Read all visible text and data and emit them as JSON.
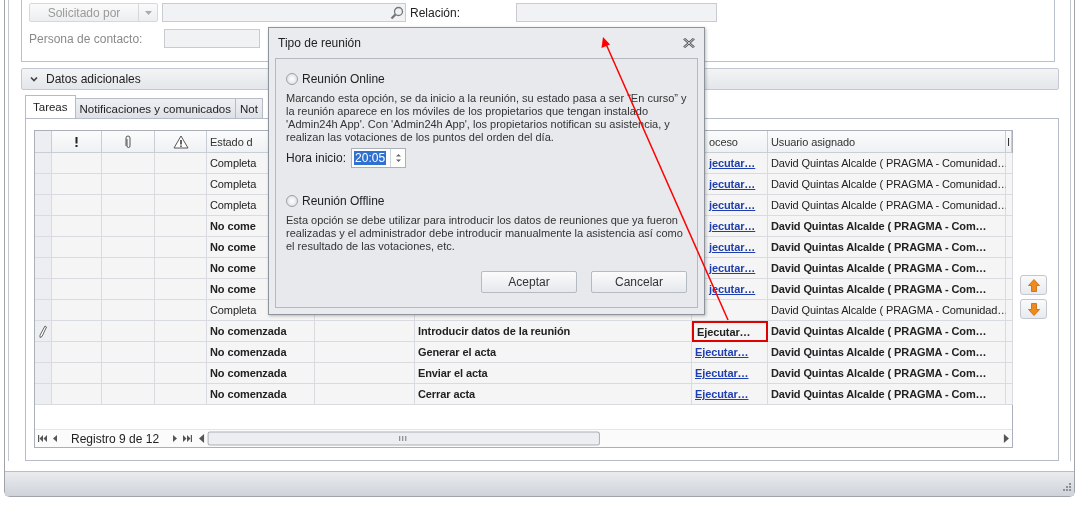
{
  "form": {
    "requester_button": {
      "label": "Solicitado por",
      "disabled": true
    },
    "relation_label": "Relación:",
    "contact_label": "Persona de contacto:"
  },
  "section": {
    "label": "Datos adicionales",
    "expanded": false
  },
  "tabs": [
    {
      "label": "Tareas",
      "selected": true
    },
    {
      "label": "Notificaciones y comunicados",
      "selected": false
    },
    {
      "label": "Not",
      "selected": false
    }
  ],
  "table": {
    "columns": [
      "Estado d",
      "oceso",
      "Usuario asignado",
      "I"
    ],
    "rows": [
      {
        "estado": "Completa",
        "proceso": "jecutar…",
        "proceso_link": true,
        "usuario": "David Quintas Alcalde ( PRAGMA - Comunidad…",
        "emphasized": false,
        "editing": false,
        "highlighted": false
      },
      {
        "estado": "Completa",
        "proceso": "jecutar…",
        "proceso_link": true,
        "usuario": "David Quintas Alcalde ( PRAGMA - Comunidad…",
        "emphasized": false,
        "editing": false,
        "highlighted": false
      },
      {
        "estado": "Completa",
        "proceso": "jecutar…",
        "proceso_link": true,
        "usuario": "David Quintas Alcalde ( PRAGMA - Comunidad…",
        "emphasized": false,
        "editing": false,
        "highlighted": false
      },
      {
        "estado": "No come",
        "proceso": "jecutar…",
        "proceso_link": true,
        "usuario": "David Quintas Alcalde ( PRAGMA - Com…",
        "emphasized": true,
        "editing": false,
        "highlighted": false
      },
      {
        "estado": "No come",
        "proceso": "jecutar…",
        "proceso_link": true,
        "usuario": "David Quintas Alcalde ( PRAGMA - Com…",
        "emphasized": true,
        "editing": false,
        "highlighted": false
      },
      {
        "estado": "No come",
        "proceso": "jecutar…",
        "proceso_link": true,
        "usuario": "David Quintas Alcalde ( PRAGMA - Com…",
        "emphasized": true,
        "editing": false,
        "highlighted": false
      },
      {
        "estado": "No come",
        "proceso": "jecutar…",
        "proceso_link": true,
        "usuario": "David Quintas Alcalde ( PRAGMA - Com…",
        "emphasized": true,
        "editing": false,
        "highlighted": false
      },
      {
        "estado": "Completa",
        "usuario": "David Quintas Alcalde ( PRAGMA - Comunidad…",
        "emphasized": false,
        "editing": false,
        "highlighted": false
      },
      {
        "estado": "No comenzada",
        "title": "Introducir datos de la reunión",
        "proceso": "Ejecutar…",
        "proceso_link": false,
        "usuario": "David Quintas Alcalde ( PRAGMA - Com…",
        "emphasized": true,
        "editing": true,
        "highlighted": true
      },
      {
        "estado": "No comenzada",
        "title": "Generar el acta",
        "proceso": "Ejecutar…",
        "proceso_link": true,
        "usuario": "David Quintas Alcalde ( PRAGMA - Com…",
        "emphasized": true,
        "editing": false,
        "highlighted": false
      },
      {
        "estado": "No comenzada",
        "title": "Enviar el acta",
        "proceso": "Ejecutar…",
        "proceso_link": true,
        "usuario": "David Quintas Alcalde ( PRAGMA - Com…",
        "emphasized": true,
        "editing": false,
        "highlighted": false
      },
      {
        "estado": "No comenzada",
        "title": "Cerrar acta",
        "proceso": "Ejecutar…",
        "proceso_link": true,
        "usuario": "David Quintas Alcalde ( PRAGMA - Com…",
        "emphasized": true,
        "editing": false,
        "highlighted": false
      }
    ]
  },
  "pager": {
    "label": "Registro 9 de 12"
  },
  "dialog": {
    "title": "Tipo de reunión",
    "options": [
      {
        "label": "Reunión Online",
        "selected": false,
        "description": "Marcando esta opción, se da inicio a la reunión, su estado pasa a ser “En curso” y la reunión aparece en los móviles de los propietarios que tengan instalado 'Admin24h App'. Con 'Admin24h App', los propietarios notifican su asistencia, y realizan las votaciones de los puntos del orden del día.",
        "time": {
          "label": "Hora inicio:",
          "value": "20:05",
          "highlighted": true
        }
      },
      {
        "label": "Reunión Offline",
        "selected": false,
        "description": "Esta opción se debe utilizar para introducir los datos de reuniones que ya fueron realizadas y el administrador debe introducir manualmente la asistencia así como el resultado de las votaciones, etc."
      }
    ],
    "buttons": [
      "Aceptar",
      "Cancelar"
    ]
  }
}
